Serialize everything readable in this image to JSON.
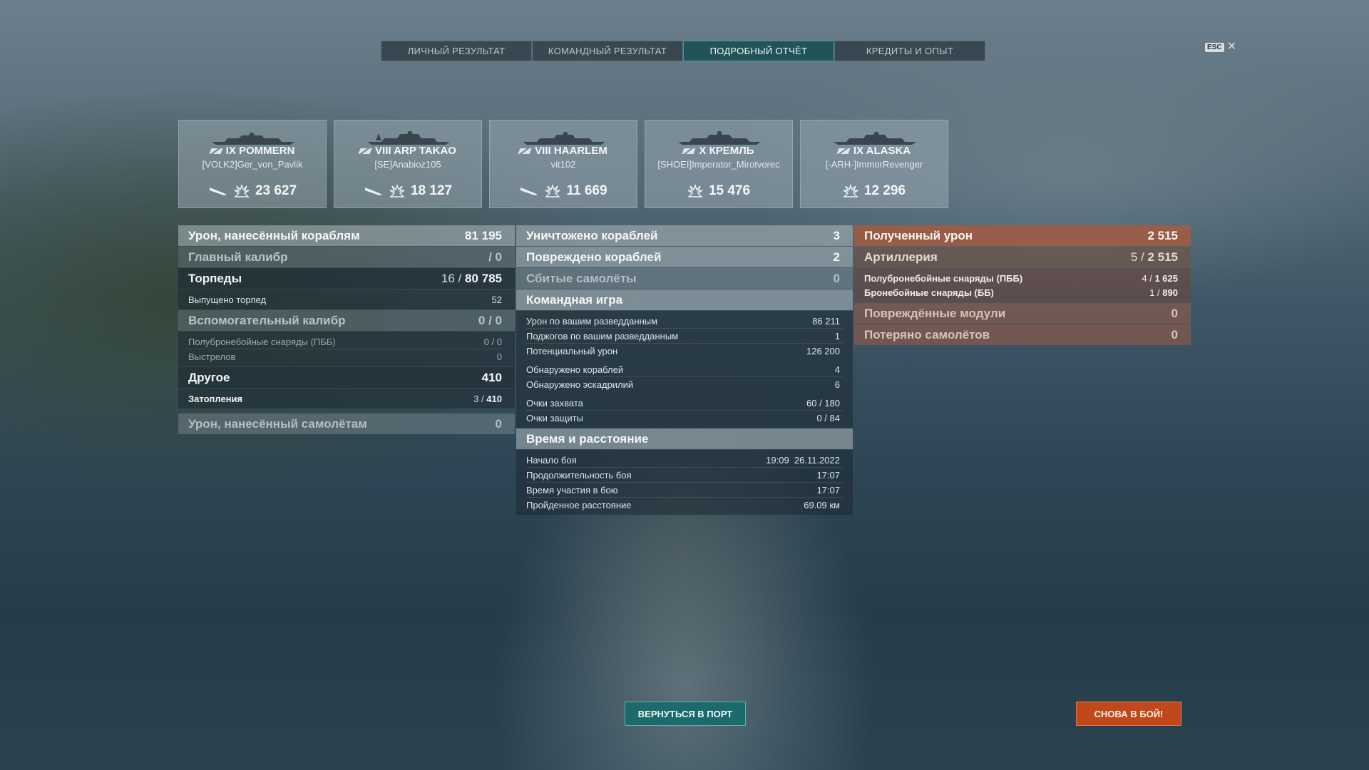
{
  "tabs": [
    "ЛИЧНЫЙ РЕЗУЛЬТАТ",
    "КОМАНДНЫЙ РЕЗУЛЬТАТ",
    "ПОДРОБНЫЙ ОТЧЁТ",
    "КРЕДИТЫ И ОПЫТ"
  ],
  "active_tab": "ПОДРОБНЫЙ ОТЧЁТ",
  "esc": {
    "label": "ESC",
    "close": "✕"
  },
  "ships": [
    {
      "name": "IX POMMERN",
      "player": "[VOLK2]Ger_von_Pavlik",
      "damage": "23 627",
      "torpedo_icon": true
    },
    {
      "name": "VIII ARP TAKAO",
      "player": "[SE]Anabioz105",
      "damage": "18 127",
      "torpedo_icon": true
    },
    {
      "name": "VIII HAARLEM",
      "player": "vit102",
      "damage": "11 669",
      "torpedo_icon": true
    },
    {
      "name": "X КРЕМЛЬ",
      "player": "[SHOEI]Imperator_Mirotvorec",
      "damage": "15 476",
      "torpedo_icon": false
    },
    {
      "name": "IX ALASKA",
      "player": "[-ARH-]ImmorRevenger",
      "damage": "12 296",
      "torpedo_icon": false
    }
  ],
  "col1": {
    "ship_damage": {
      "label": "Урон, нанесённый кораблям",
      "value": "81 195"
    },
    "main_caliber": {
      "label": "Главный калибр",
      "value": "/ 0"
    },
    "torpedoes": {
      "label": "Торпеды",
      "hits": "16 /",
      "value": "80 785"
    },
    "torpedoes_fired": {
      "label": "Выпущено торпед",
      "value": "52"
    },
    "secondary": {
      "label": "Вспомогательный калибр",
      "value": "0 / 0"
    },
    "secondary_he": {
      "label": "Полубронебойные снаряды (ПББ)",
      "value": "0 / 0"
    },
    "secondary_shots": {
      "label": "Выстрелов",
      "value": "0"
    },
    "other": {
      "label": "Другое",
      "value": "410"
    },
    "flooding": {
      "label": "Затопления",
      "hits": "3 /",
      "value": "410"
    },
    "plane_damage": {
      "label": "Урон, нанесённый самолётам",
      "value": "0"
    }
  },
  "col2": {
    "destroyed": {
      "label": "Уничтожено кораблей",
      "value": "3"
    },
    "damaged": {
      "label": "Повреждено кораблей",
      "value": "2"
    },
    "planes_shot": {
      "label": "Сбитые самолёты",
      "value": "0"
    },
    "teamplay": {
      "label": "Командная игра"
    },
    "spotting_damage": {
      "label": "Урон по вашим разведданным",
      "value": "86 211"
    },
    "spotting_fires": {
      "label": "Поджогов по вашим разведданным",
      "value": "1"
    },
    "potential_damage": {
      "label": "Потенциальный урон",
      "value": "126 200"
    },
    "ships_spotted": {
      "label": "Обнаружено кораблей",
      "value": "4"
    },
    "squadrons_spotted": {
      "label": "Обнаружено эскадрилий",
      "value": "6"
    },
    "capture_points": {
      "label": "Очки захвата",
      "value": "60 / 180"
    },
    "defense_points": {
      "label": "Очки защиты",
      "value": "0 / 84"
    },
    "time_distance": {
      "label": "Время и расстояние"
    },
    "battle_start": {
      "label": "Начало боя",
      "value": "19:09  26.11.2022"
    },
    "battle_duration": {
      "label": "Продолжительность боя",
      "value": "17:07"
    },
    "time_in_battle": {
      "label": "Время участия в бою",
      "value": "17:07"
    },
    "distance": {
      "label": "Пройденное расстояние",
      "value": "69.09 км"
    }
  },
  "col3": {
    "received": {
      "label": "Полученный урон",
      "value": "2 515"
    },
    "artillery": {
      "label": "Артиллерия",
      "hits": "5 /",
      "value": "2 515"
    },
    "he_shells": {
      "label": "Полубронебойные снаряды (ПББ)",
      "hits": "4 /",
      "value": "1 625"
    },
    "ap_shells": {
      "label": "Бронебойные снаряды (ББ)",
      "hits": "1 /",
      "value": "890"
    },
    "modules": {
      "label": "Повреждённые модули",
      "value": "0"
    },
    "planes_lost": {
      "label": "Потеряно самолётов",
      "value": "0"
    }
  },
  "buttons": {
    "port": "ВЕРНУТЬСЯ В ПОРТ",
    "battle": "СНОВА В БОЙ!"
  },
  "colors": {
    "active_tab": "#1d6a6c",
    "battle_button": "#c0481a",
    "received_header": "#aa5a3c"
  }
}
